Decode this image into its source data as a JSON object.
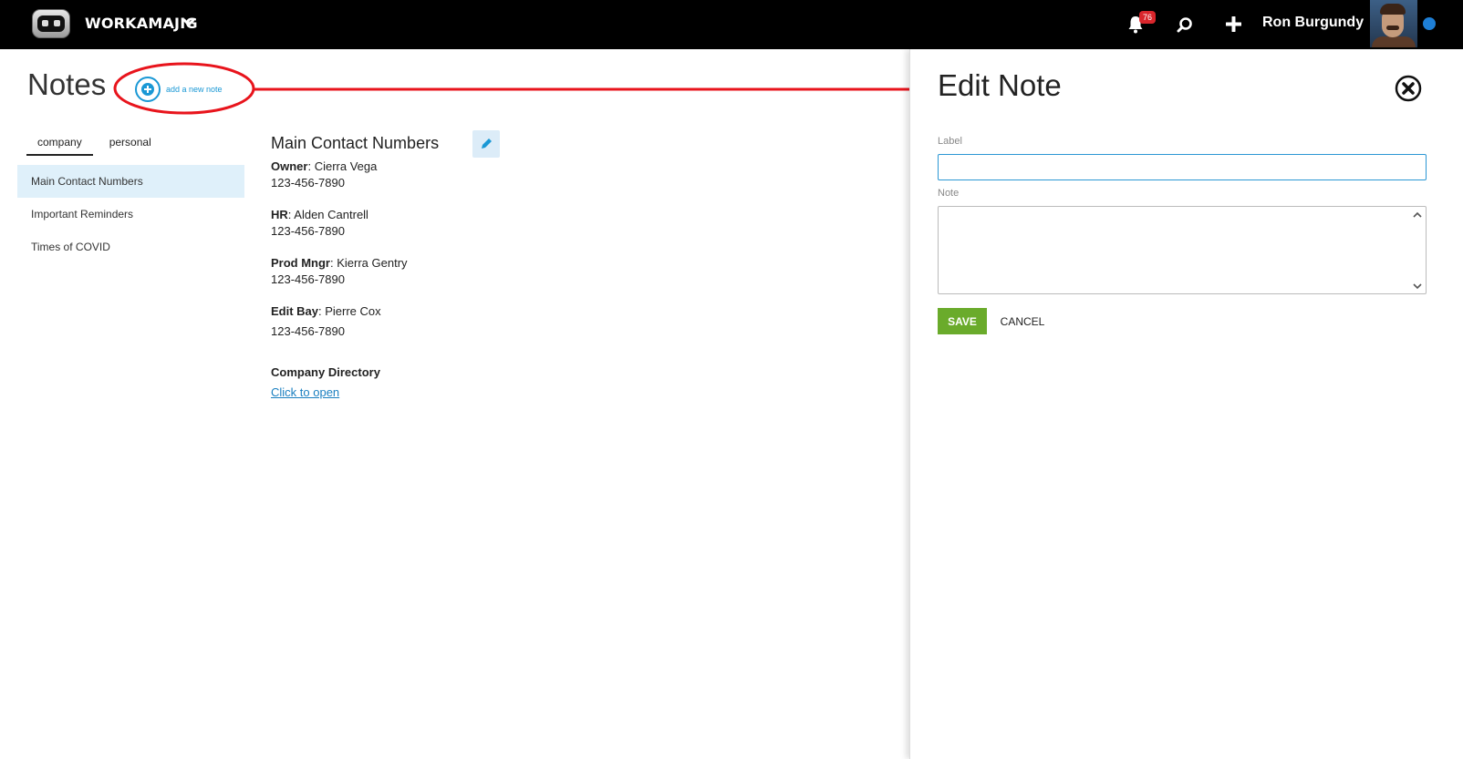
{
  "header": {
    "brand": "WORKAMAJIG",
    "notification_count": "76",
    "user_name": "Ron Burgundy",
    "icons": [
      "logo-icon",
      "chevron-down-icon",
      "bell-icon",
      "search-icon",
      "plus-icon",
      "avatar"
    ]
  },
  "notes_page": {
    "title": "Notes",
    "add_note_label": "add a new note",
    "tabs": [
      {
        "label": "company",
        "active": true
      },
      {
        "label": "personal",
        "active": false
      }
    ],
    "note_list": [
      {
        "label": "Main Contact Numbers",
        "selected": true
      },
      {
        "label": "Important Reminders",
        "selected": false
      },
      {
        "label": "Times of COVID",
        "selected": false
      }
    ],
    "selected_note": {
      "title": "Main Contact Numbers",
      "entries": [
        {
          "role": "Owner",
          "name": ": Cierra Vega",
          "phone": "123-456-7890"
        },
        {
          "role": "HR",
          "name": ": Alden Cantrell",
          "phone": "123-456-7890"
        },
        {
          "role": "Prod Mngr",
          "name": ": Kierra Gentry",
          "phone": "123-456-7890"
        },
        {
          "role": "Edit Bay",
          "name": ": Pierre Cox",
          "phone": "123-456-7890"
        }
      ],
      "directory_label": "Company Directory",
      "directory_link": "Click to open"
    }
  },
  "edit_panel": {
    "title": "Edit Note",
    "label_field_label": "Label",
    "label_value": "",
    "note_field_label": "Note",
    "note_value": "",
    "save_label": "SAVE",
    "cancel_label": "CANCEL"
  },
  "colors": {
    "accent": "#1a98d5",
    "save_green": "#6aab2b",
    "annotation_red": "#e8141c",
    "selected_bg": "#dff0fa",
    "badge_red": "#d9262c"
  }
}
